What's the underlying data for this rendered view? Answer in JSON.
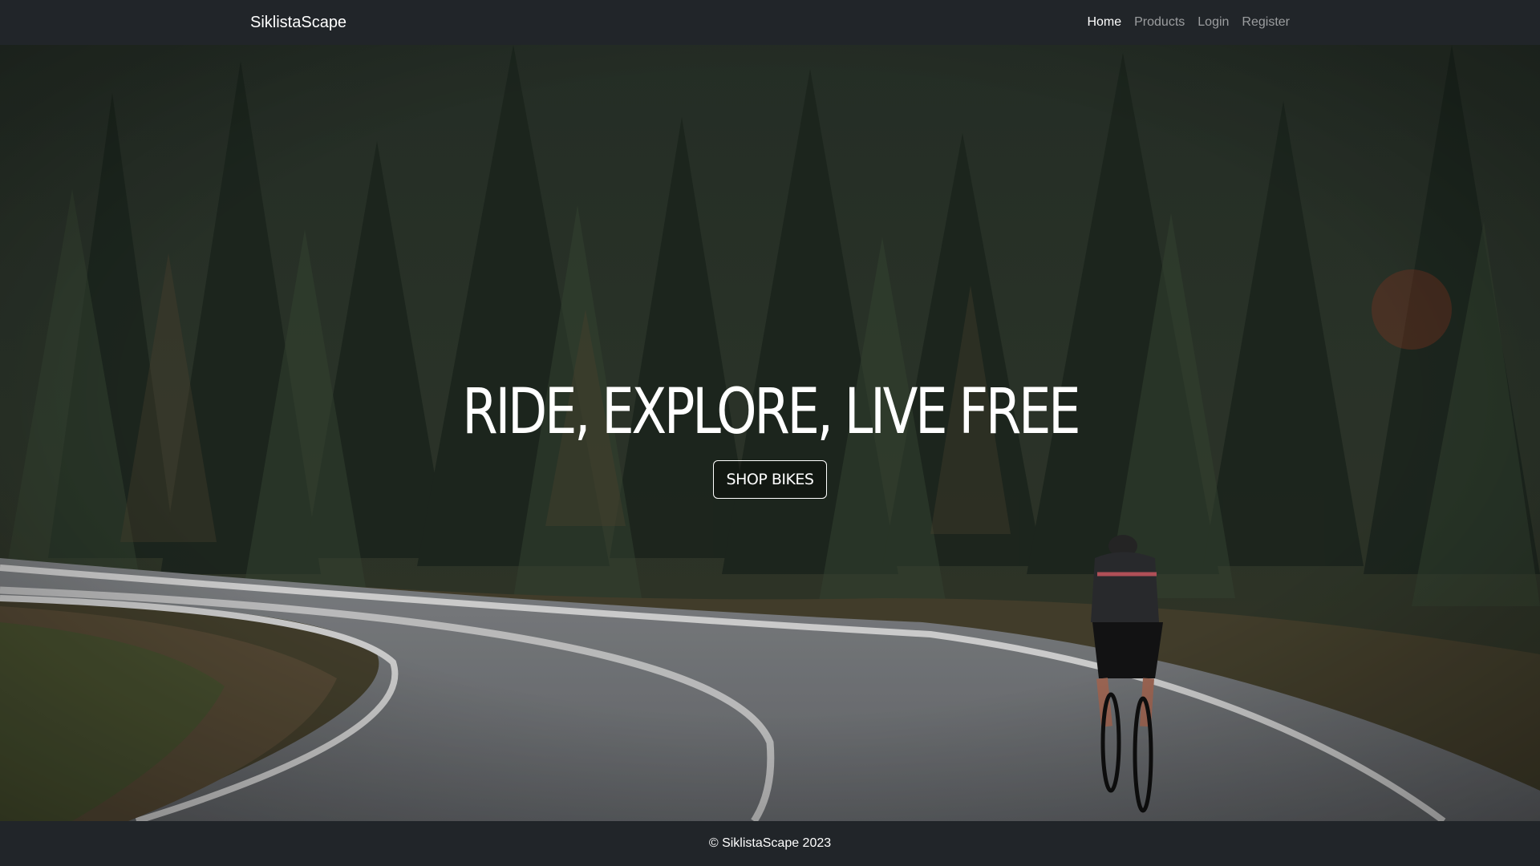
{
  "navbar": {
    "brand": "SiklistaScape",
    "links": [
      {
        "label": "Home",
        "active": true
      },
      {
        "label": "Products",
        "active": false
      },
      {
        "label": "Login",
        "active": false
      },
      {
        "label": "Register",
        "active": false
      }
    ]
  },
  "hero": {
    "title": "RIDE, EXPLORE, LIVE FREE",
    "button_label": "SHOP BIKES",
    "image_description": "forest-road-cyclist"
  },
  "footer": {
    "text": "© SiklistaScape 2023"
  },
  "colors": {
    "navbar_bg": "#212529",
    "footer_bg": "#212529",
    "nav_active": "#ffffff",
    "nav_inactive": "rgba(255,255,255,0.55)"
  }
}
